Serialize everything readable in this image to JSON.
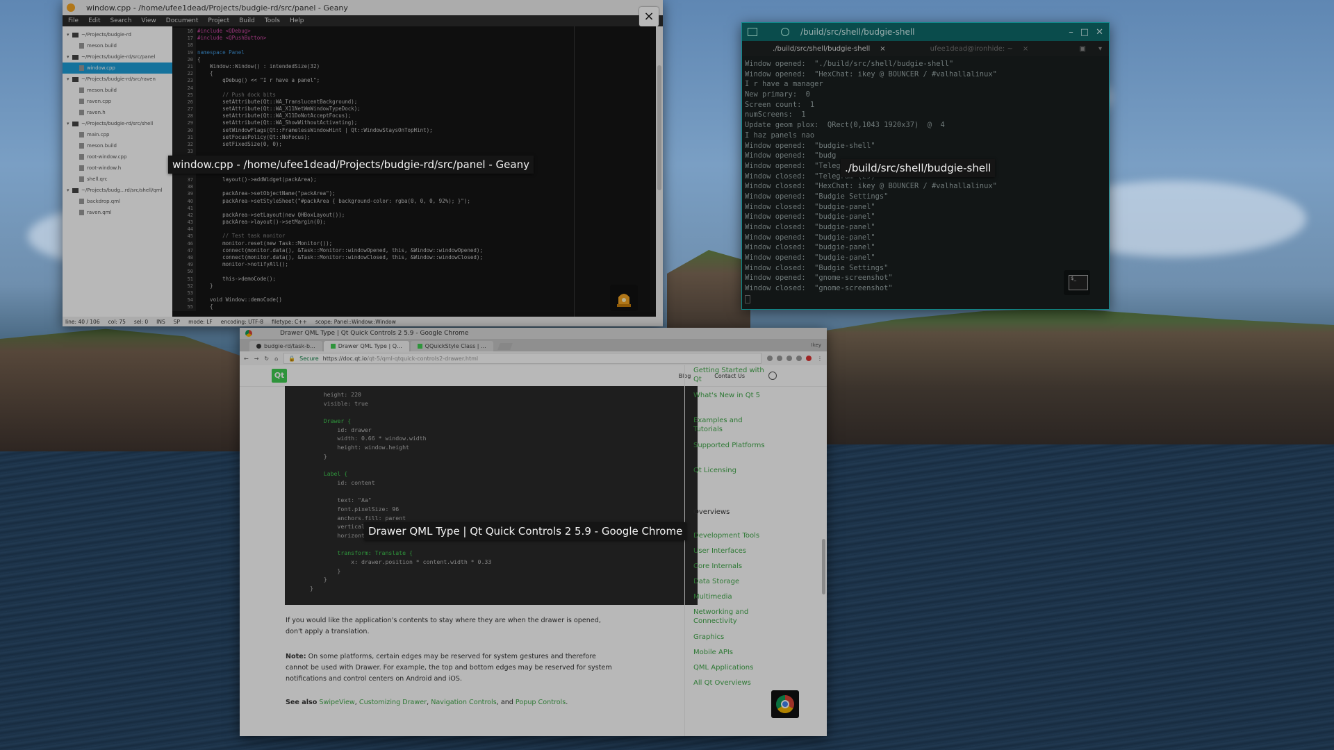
{
  "geany": {
    "title": "window.cpp - /home/ufee1dead/Projects/budgie-rd/src/panel - Geany",
    "close_glyph": "×",
    "menu": [
      "File",
      "Edit",
      "Search",
      "View",
      "Document",
      "Project",
      "Build",
      "Tools",
      "Help"
    ],
    "tree": [
      {
        "label": "~/Projects/budgie-rd",
        "kind": "folder",
        "depth": 0
      },
      {
        "label": "meson.build",
        "kind": "file",
        "depth": 1
      },
      {
        "label": "~/Projects/budgie-rd/src/panel",
        "kind": "folder",
        "depth": 0
      },
      {
        "label": "window.cpp",
        "kind": "file",
        "depth": 1,
        "selected": true
      },
      {
        "label": "~/Projects/budgie-rd/src/raven",
        "kind": "folder",
        "depth": 0
      },
      {
        "label": "meson.build",
        "kind": "file",
        "depth": 1
      },
      {
        "label": "raven.cpp",
        "kind": "file",
        "depth": 1
      },
      {
        "label": "raven.h",
        "kind": "file",
        "depth": 1
      },
      {
        "label": "~/Projects/budgie-rd/src/shell",
        "kind": "folder",
        "depth": 0
      },
      {
        "label": "main.cpp",
        "kind": "file",
        "depth": 1
      },
      {
        "label": "meson.build",
        "kind": "file",
        "depth": 1
      },
      {
        "label": "root-window.cpp",
        "kind": "file",
        "depth": 1
      },
      {
        "label": "root-window.h",
        "kind": "file",
        "depth": 1
      },
      {
        "label": "shell.qrc",
        "kind": "file",
        "depth": 1
      },
      {
        "label": "~/Projects/budg...rd/src/shell/qml",
        "kind": "folder",
        "depth": 0
      },
      {
        "label": "backdrop.qml",
        "kind": "file",
        "depth": 1
      },
      {
        "label": "raven.qml",
        "kind": "file",
        "depth": 1
      }
    ],
    "lines": [
      {
        "n": "16",
        "t": "#include <QDebug>"
      },
      {
        "n": "17",
        "t": "#include <QPushButton>"
      },
      {
        "n": "18",
        "t": ""
      },
      {
        "n": "19",
        "t": "namespace Panel"
      },
      {
        "n": "20",
        "t": "{"
      },
      {
        "n": "21",
        "t": "    Window::Window() : intendedSize(32)"
      },
      {
        "n": "22",
        "t": "    {"
      },
      {
        "n": "23",
        "t": "        qDebug() << \"I r have a panel\";"
      },
      {
        "n": "24",
        "t": ""
      },
      {
        "n": "25",
        "t": "        // Push dock bits"
      },
      {
        "n": "26",
        "t": "        setAttribute(Qt::WA_TranslucentBackground);"
      },
      {
        "n": "27",
        "t": "        setAttribute(Qt::WA_X11NetWmWindowTypeDock);"
      },
      {
        "n": "28",
        "t": "        setAttribute(Qt::WA_X11DoNotAcceptFocus);"
      },
      {
        "n": "29",
        "t": "        setAttribute(Qt::WA_ShowWithoutActivating);"
      },
      {
        "n": "30",
        "t": "        setWindowFlags(Qt::FramelessWindowHint | Qt::WindowStaysOnTopHint);"
      },
      {
        "n": "31",
        "t": "        setFocusPolicy(Qt::NoFocus);"
      },
      {
        "n": "32",
        "t": "        setFixedSize(0, 0);"
      },
      {
        "n": "33",
        "t": ""
      },
      {
        "n": "",
        "t": ""
      },
      {
        "n": "",
        "t": ""
      },
      {
        "n": "",
        "t": ""
      },
      {
        "n": "37",
        "t": "        layout()->addWidget(packArea);"
      },
      {
        "n": "38",
        "t": ""
      },
      {
        "n": "39",
        "t": "        packArea->setObjectName(\"packArea\");"
      },
      {
        "n": "40",
        "t": "        packArea->setStyleSheet(\"#packArea { background-color: rgba(0, 0, 0, 92%); }\");"
      },
      {
        "n": "41",
        "t": ""
      },
      {
        "n": "42",
        "t": "        packArea->setLayout(new QHBoxLayout());"
      },
      {
        "n": "43",
        "t": "        packArea->layout()->setMargin(0);"
      },
      {
        "n": "44",
        "t": ""
      },
      {
        "n": "45",
        "t": "        // Test task monitor"
      },
      {
        "n": "46",
        "t": "        monitor.reset(new Task::Monitor());"
      },
      {
        "n": "47",
        "t": "        connect(monitor.data(), &Task::Monitor::windowOpened, this, &Window::windowOpened);"
      },
      {
        "n": "48",
        "t": "        connect(monitor.data(), &Task::Monitor::windowClosed, this, &Window::windowClosed);"
      },
      {
        "n": "49",
        "t": "        monitor->notifyAll();"
      },
      {
        "n": "50",
        "t": ""
      },
      {
        "n": "51",
        "t": "        this->demoCode();"
      },
      {
        "n": "52",
        "t": "    }"
      },
      {
        "n": "53",
        "t": ""
      },
      {
        "n": "54",
        "t": "    void Window::demoCode()"
      },
      {
        "n": "55",
        "t": "    {"
      }
    ],
    "status": [
      "line: 40 / 106",
      "col: 75",
      "sel: 0",
      "INS",
      "SP",
      "mode: LF",
      "encoding: UTF-8",
      "filetype: C++",
      "scope: Panel::Window::Window"
    ]
  },
  "terminal": {
    "title": "/build/src/shell/budgie-shell",
    "tabs": [
      {
        "label": "./build/src/shell/budgie-shell",
        "active": true
      },
      {
        "label": "ufee1dead@ironhide: ~",
        "active": false
      }
    ],
    "close_glyph": "×",
    "output": [
      "Window opened:  \"./build/src/shell/budgie-shell\"",
      "Window opened:  \"HexChat: ikey @ BOUNCER / #valhallalinux\"",
      "I r have a manager",
      "New primary:  0",
      "Screen count:  1",
      "numScreens:  1",
      "Update geom plox:  QRect(0,1043 1920x37)  @  4",
      "I haz panels nao",
      "Window opened:  \"budgie-shell\"",
      "Window opened:  \"budg",
      "Window opened:  \"Teleg",
      "Window closed:  \"Telegram (29)\"",
      "Window closed:  \"HexChat: ikey @ BOUNCER / #valhallalinux\"",
      "Window opened:  \"Budgie Settings\"",
      "Window closed:  \"budgie-panel\"",
      "Window opened:  \"budgie-panel\"",
      "Window closed:  \"budgie-panel\"",
      "Window opened:  \"budgie-panel\"",
      "Window closed:  \"budgie-panel\"",
      "Window opened:  \"budgie-panel\"",
      "Window closed:  \"Budgie Settings\"",
      "Window opened:  \"gnome-screenshot\"",
      "Window closed:  \"gnome-screenshot\""
    ],
    "badge_text": "$_"
  },
  "chrome": {
    "title": "Drawer QML Type | Qt Quick Controls 2 5.9 - Google Chrome",
    "tabs": [
      {
        "label": "budgie-rd/task-b...",
        "active": false,
        "icon": "github-icon"
      },
      {
        "label": "Drawer QML Type | Q...",
        "active": true,
        "icon": "qt-icon"
      },
      {
        "label": "QQuickStyle Class | ...",
        "active": false,
        "icon": "qt-icon"
      }
    ],
    "profile": "Ikey",
    "url_secure": "Secure",
    "url_host": "https://doc.qt.io",
    "url_path": "/qt-5/qml-qtquick-controls2-drawer.html",
    "logo": "Qt",
    "nav": [
      "Blog",
      "Contact Us"
    ],
    "code": [
      {
        "t": "    height: 220",
        "tone": "plain"
      },
      {
        "t": "    visible: true",
        "tone": "plain"
      },
      {
        "t": "",
        "tone": "plain"
      },
      {
        "t": "    Drawer {",
        "tone": "keyword"
      },
      {
        "t": "        id: drawer",
        "tone": "plain"
      },
      {
        "t": "        width: 0.66 * window.width",
        "tone": "plain"
      },
      {
        "t": "        height: window.height",
        "tone": "plain"
      },
      {
        "t": "    }",
        "tone": "plain"
      },
      {
        "t": "",
        "tone": "plain"
      },
      {
        "t": "    Label {",
        "tone": "keyword"
      },
      {
        "t": "        id: content",
        "tone": "plain"
      },
      {
        "t": "",
        "tone": "plain"
      },
      {
        "t": "        text: \"Aa\"",
        "tone": "plain"
      },
      {
        "t": "        font.pixelSize: 96",
        "tone": "plain"
      },
      {
        "t": "        anchors.fill: parent",
        "tone": "plain"
      },
      {
        "t": "        verticalAl",
        "tone": "plain"
      },
      {
        "t": "        horizontalA",
        "tone": "plain"
      },
      {
        "t": "",
        "tone": "plain"
      },
      {
        "t": "        transform: Translate {",
        "tone": "keyword"
      },
      {
        "t": "            x: drawer.position * content.width * 0.33",
        "tone": "plain"
      },
      {
        "t": "        }",
        "tone": "plain"
      },
      {
        "t": "    }",
        "tone": "plain"
      },
      {
        "t": "}",
        "tone": "plain"
      }
    ],
    "para1": "If you would like the application's contents to stay where they are when the drawer is opened, don't apply a translation.",
    "note_label": "Note:",
    "note_body": " On some platforms, certain edges may be reserved for system gestures and therefore cannot be used with Drawer. For example, the top and bottom edges may be reserved for system notifications and control centers on Android and iOS.",
    "see_also_label": "See also",
    "see_also_links": [
      "SwipeView",
      "Customizing Drawer",
      "Navigation Controls",
      "Popup Controls"
    ],
    "see_also_seps": [
      ", ",
      ", ",
      ", and ",
      "."
    ],
    "sidebar_top": [
      "Getting Started with Qt",
      "What's New in Qt 5",
      "Examples and Tutorials",
      "Supported Platforms",
      "Qt Licensing"
    ],
    "sidebar_heading": "Overviews",
    "sidebar_overviews": [
      "Development Tools",
      "User Interfaces",
      "Core Internals",
      "Data Storage",
      "Multimedia",
      "Networking and Connectivity",
      "Graphics",
      "Mobile APIs",
      "QML Applications",
      "All Qt Overviews"
    ]
  },
  "tooltips": {
    "geany": "window.cpp - /home/ufee1dead/Projects/budgie-rd/src/panel - Geany",
    "terminal": "./build/src/shell/budgie-shell",
    "chrome": "Drawer QML Type | Qt Quick Controls 2 5.9 - Google Chrome"
  },
  "colors": {
    "geany_accent": "#1e9fd8",
    "terminal_accent": "#0f6a6a",
    "qt_green": "#41cd52",
    "code_keyword_green": "#41cd52",
    "code_number_red": "#f05a5a"
  }
}
